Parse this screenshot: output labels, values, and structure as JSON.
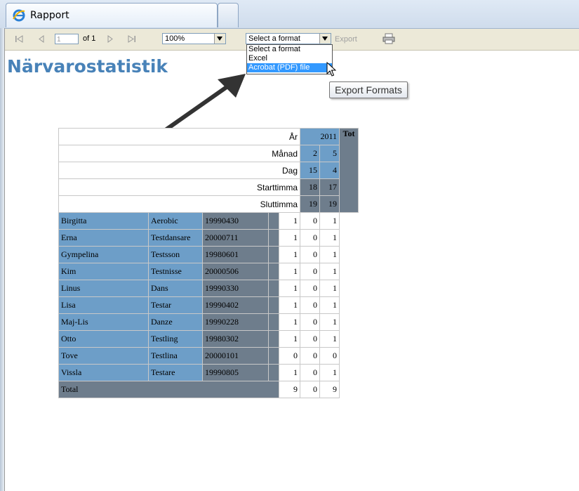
{
  "browser": {
    "tab_title": "Rapport"
  },
  "toolbar": {
    "first_page_icon": "first-page-icon",
    "prev_page_icon": "previous-page-icon",
    "page_value": "1",
    "of_pages": "of 1",
    "next_page_icon": "next-page-icon",
    "last_page_icon": "last-page-icon",
    "zoom_value": "100%",
    "format_value": "Select a format",
    "export_label": "Export",
    "print_icon": "print-icon"
  },
  "format_dropdown": {
    "options": [
      "Select a format",
      "Excel",
      "Acrobat (PDF) file"
    ],
    "highlighted": "Acrobat (PDF) file"
  },
  "tooltip": "Export Formats",
  "report": {
    "title": "Närvarostatistik",
    "header_labels": {
      "year": "År",
      "month": "Månad",
      "day": "Dag",
      "start_hour": "Starttimma",
      "end_hour": "Sluttimma",
      "total": "Tot"
    },
    "columns": [
      {
        "year": "2011",
        "month": "2",
        "day": "15",
        "start": "18",
        "end": "19"
      },
      {
        "year": "",
        "month": "5",
        "day": "4",
        "start": "17",
        "end": "19"
      }
    ],
    "rows": [
      {
        "name": "Birgitta",
        "class": "Aerobic",
        "id": "19990430",
        "v1": "1",
        "v2": "0",
        "tot": "1"
      },
      {
        "name": "Erna",
        "class": "Testdansare",
        "id": "20000711",
        "v1": "1",
        "v2": "0",
        "tot": "1"
      },
      {
        "name": "Gympelina",
        "class": "Testsson",
        "id": "19980601",
        "v1": "1",
        "v2": "0",
        "tot": "1"
      },
      {
        "name": "Kim",
        "class": "Testnisse",
        "id": "20000506",
        "v1": "1",
        "v2": "0",
        "tot": "1"
      },
      {
        "name": "Linus",
        "class": "Dans",
        "id": "19990330",
        "v1": "1",
        "v2": "0",
        "tot": "1"
      },
      {
        "name": "Lisa",
        "class": "Testar",
        "id": "19990402",
        "v1": "1",
        "v2": "0",
        "tot": "1"
      },
      {
        "name": "Maj-Lis",
        "class": "Danze",
        "id": "19990228",
        "v1": "1",
        "v2": "0",
        "tot": "1"
      },
      {
        "name": "Otto",
        "class": "Testling",
        "id": "19980302",
        "v1": "1",
        "v2": "0",
        "tot": "1"
      },
      {
        "name": "Tove",
        "class": "Testlina",
        "id": "20000101",
        "v1": "0",
        "v2": "0",
        "tot": "0"
      },
      {
        "name": "Vissla",
        "class": "Testare",
        "id": "19990805",
        "v1": "1",
        "v2": "0",
        "tot": "1"
      }
    ],
    "total_row": {
      "label": "Total",
      "v1": "9",
      "v2": "0",
      "tot": "9"
    }
  },
  "colors": {
    "title": "#4882b8",
    "cell_blue": "#6d9ec8",
    "cell_grey": "#6e7d8c",
    "highlight": "#3399ff"
  }
}
